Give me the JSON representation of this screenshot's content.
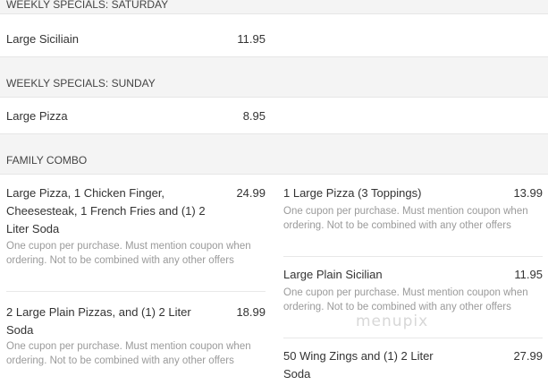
{
  "sections": {
    "saturday": {
      "header": "WEEKLY SPECIALS: SATURDAY",
      "item": {
        "name": "Large Siciliain",
        "price": "11.95"
      }
    },
    "sunday": {
      "header": "WEEKLY SPECIALS: SUNDAY",
      "item": {
        "name": "Large Pizza",
        "price": "8.95"
      }
    },
    "family_combo": {
      "header": "FAMILY COMBO",
      "items": [
        {
          "name": "Large Pizza, 1 Chicken Finger, Cheesesteak, 1 French Fries and (1) 2 Liter Soda",
          "price": "24.99",
          "desc": "One cupon per purchase. Must mention coupon when ordering. Not to be combined with any other offers"
        },
        {
          "name": "2 Large Plain Pizzas, and (1) 2 Liter Soda",
          "price": "18.99",
          "desc": "One cupon per purchase. Must mention coupon when ordering. Not to be combined with any other offers"
        },
        {
          "name": "1 Large Pizza (3 Toppings)",
          "price": "13.99",
          "desc": "One cupon per purchase. Must mention coupon when ordering. Not to be combined with any other offers"
        },
        {
          "name": "Large Plain Sicilian",
          "price": "11.95",
          "desc": "One cupon per purchase. Must mention coupon when ordering. Not to be combined with any other offers"
        },
        {
          "name": "50 Wing Zings and (1) 2 Liter Soda",
          "price": "27.99",
          "desc": ""
        }
      ]
    }
  },
  "watermark": "menupix"
}
